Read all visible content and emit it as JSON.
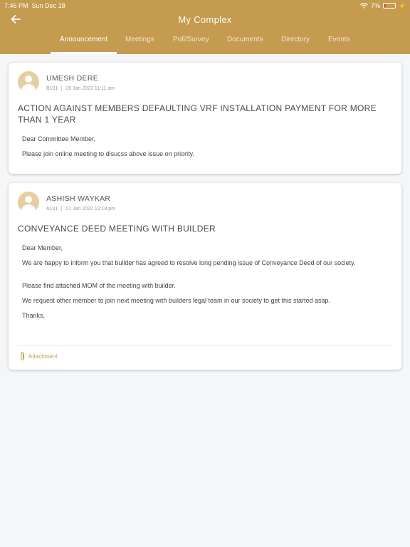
{
  "status_bar": {
    "time": "7:46 PM",
    "date": "Sun Dec 18",
    "battery": "7%"
  },
  "header": {
    "title": "My Complex"
  },
  "tabs": [
    {
      "label": "Announcement"
    },
    {
      "label": "Meetings"
    },
    {
      "label": "Poll/Survey"
    },
    {
      "label": "Documents"
    },
    {
      "label": "Directory"
    },
    {
      "label": "Events"
    }
  ],
  "announcements": [
    {
      "author": "UMESH DERE",
      "unit": "B101",
      "datetime": "26 Jan 2022 11:11 am",
      "title": "ACTION AGAINST MEMBERS DEFAULTING VRF INSTALLATION PAYMENT FOR MORE THAN 1 YEAR",
      "body": [
        "Dear Committee Member,",
        "Please join online meeting to disucss above issue on priority."
      ]
    },
    {
      "author": "ASHISH WAYKAR",
      "unit": "A101",
      "datetime": "01 Jan 2022 12:18 pm",
      "title": "CONVEYANCE DEED MEETING WITH BUILDER",
      "body": [
        "Dear Member,",
        "We are happy to inform you that builder has agreed to resolve long pending issue of Conveyance Deed of our society.",
        "Please find attached MOM of the meeting with builder.",
        "We request other member to join next meeting with builders legal team in our society to get this started asap.",
        "Thanks,"
      ],
      "attachment_label": "Attachment"
    }
  ]
}
